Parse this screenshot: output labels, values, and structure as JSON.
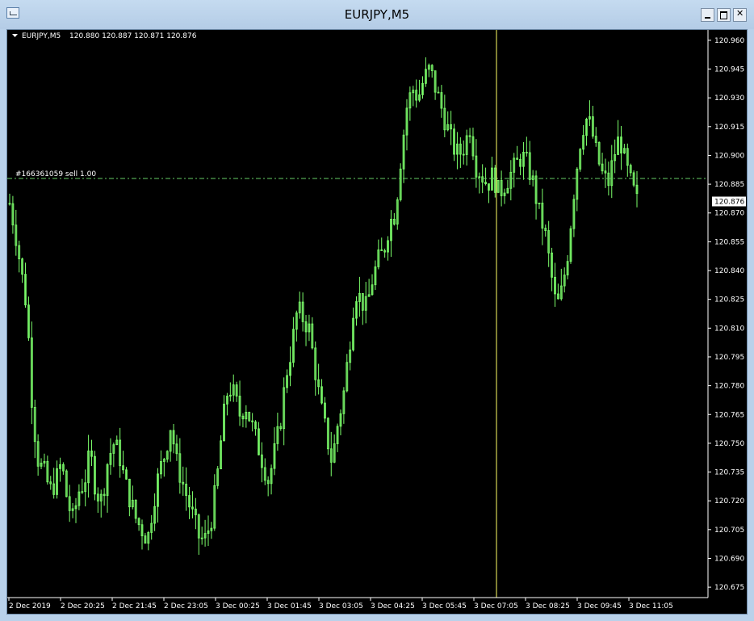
{
  "window": {
    "title": "EURJPY,M5"
  },
  "colors": {
    "background": "#000000",
    "candle": "#7cff6b",
    "axis": "#ffffff",
    "trade_line": "#66cc66",
    "crosshair": "#ffff66"
  },
  "header": {
    "symbol": "EURJPY,M5",
    "ohlc": "120.880 120.887 120.871 120.876"
  },
  "order_line": {
    "label": "#166361059 sell 1.00",
    "price": 120.888
  },
  "current_price_label": "120.876",
  "crosshair_time": "3 Dec 07:05",
  "chart_data": {
    "type": "candlestick",
    "title": "EURJPY,M5",
    "ylim": [
      120.67,
      120.965
    ],
    "y_ticks": [
      "120.960",
      "120.945",
      "120.930",
      "120.915",
      "120.900",
      "120.885",
      "120.870",
      "120.855",
      "120.840",
      "120.825",
      "120.810",
      "120.795",
      "120.780",
      "120.765",
      "120.750",
      "120.735",
      "120.720",
      "120.705",
      "120.690",
      "120.675"
    ],
    "x_ticks": [
      "2 Dec 2019",
      "2 Dec 20:25",
      "2 Dec 21:45",
      "2 Dec 23:05",
      "3 Dec 00:25",
      "3 Dec 01:45",
      "3 Dec 03:05",
      "3 Dec 04:25",
      "3 Dec 05:45",
      "3 Dec 07:05",
      "3 Dec 08:25",
      "3 Dec 09:45",
      "3 Dec 11:05"
    ],
    "close_path": [
      120.875,
      120.86,
      120.84,
      120.82,
      120.765,
      120.74,
      120.735,
      120.725,
      120.73,
      120.74,
      120.72,
      120.71,
      120.725,
      120.73,
      120.745,
      120.725,
      120.72,
      120.74,
      120.75,
      120.745,
      120.73,
      120.72,
      120.71,
      120.705,
      120.7,
      120.72,
      120.735,
      120.745,
      120.76,
      120.74,
      120.73,
      120.72,
      120.71,
      120.7,
      120.7,
      120.71,
      120.73,
      120.76,
      120.78,
      120.775,
      120.765,
      120.77,
      120.76,
      120.75,
      120.74,
      120.73,
      120.745,
      120.76,
      120.785,
      120.8,
      120.82,
      120.815,
      120.81,
      120.79,
      120.77,
      120.755,
      120.74,
      120.76,
      120.775,
      120.8,
      120.83,
      120.825,
      120.82,
      120.835,
      120.845,
      120.85,
      120.865,
      120.87,
      120.9,
      120.925,
      120.935,
      120.93,
      120.94,
      120.945,
      120.935,
      120.925,
      120.915,
      120.905,
      120.9,
      120.905,
      120.915,
      120.895,
      120.89,
      120.885,
      120.89,
      120.88,
      120.885,
      120.89,
      120.895,
      120.9,
      120.895,
      120.885,
      120.87,
      120.86,
      120.84,
      120.82,
      120.83,
      120.85,
      120.88,
      120.905,
      120.92,
      120.915,
      120.9,
      120.89,
      120.885,
      120.9,
      120.91,
      120.895,
      120.885,
      120.876
    ]
  }
}
